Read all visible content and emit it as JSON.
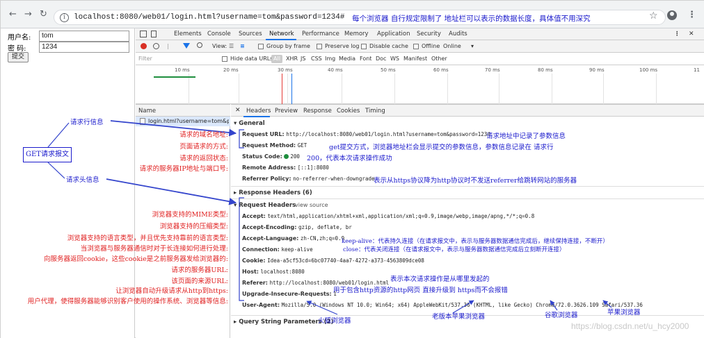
{
  "browser": {
    "url": "localhost:8080/web01/login.html?username=tom&password=1234#",
    "url_note": "每个浏览器 自行规定限制了 地址栏可以表示的数据长度，具体值不用深究"
  },
  "form": {
    "username_label": "用户名:",
    "username_value": "tom",
    "password_label": "密  码:",
    "password_value": "1234",
    "submit_label": "提交"
  },
  "devtools": {
    "tabs": [
      "Elements",
      "Console",
      "Sources",
      "Network",
      "Performance",
      "Memory",
      "Application",
      "Security",
      "Audits"
    ],
    "active_tab": "Network",
    "toolbar": {
      "view_label": "View:",
      "group_by_frame": "Group by frame",
      "preserve_log": "Preserve log",
      "disable_cache": "Disable cache",
      "offline": "Offline",
      "online": "Online"
    },
    "filter": {
      "placeholder": "Filter",
      "hide_data_urls": "Hide data URLs",
      "all": "All",
      "types": [
        "XHR",
        "JS",
        "CSS",
        "Img",
        "Media",
        "Font",
        "Doc",
        "WS",
        "Manifest",
        "Other"
      ]
    },
    "timeline_ticks": [
      "10 ms",
      "20 ms",
      "30 ms",
      "40 ms",
      "50 ms",
      "60 ms",
      "70 ms",
      "80 ms",
      "90 ms",
      "100 ms",
      "11"
    ],
    "name_column": {
      "header": "Name",
      "row": "login.html?username=tom&pa..."
    },
    "detail_tabs": [
      "Headers",
      "Preview",
      "Response",
      "Cookies",
      "Timing"
    ],
    "general": {
      "title": "General",
      "request_url_key": "Request URL:",
      "request_url_val": "http://localhost:8080/web01/login.html?username=tom&password=1234",
      "request_method_key": "Request Method:",
      "request_method_val": "GET",
      "status_code_key": "Status Code:",
      "status_code_val": "200",
      "remote_address_key": "Remote Address:",
      "remote_address_val": "[::1]:8080",
      "referrer_policy_key": "Referrer Policy:",
      "referrer_policy_val": "no-referrer-when-downgrade"
    },
    "response_headers_title": "Response Headers (6)",
    "request_headers": {
      "title": "Request Headers",
      "view_source": "view source",
      "accept_key": "Accept:",
      "accept_val": "text/html,application/xhtml+xml,application/xml;q=0.9,image/webp,image/apng,*/*;q=0.8",
      "accept_encoding_key": "Accept-Encoding:",
      "accept_encoding_val": "gzip, deflate, br",
      "accept_language_key": "Accept-Language:",
      "accept_language_val": "zh-CN,zh;q=0.9",
      "connection_key": "Connection:",
      "connection_val": "keep-alive",
      "cookie_key": "Cookie:",
      "cookie_val": "Idea-a5cf53cd=6bc07740-4aa7-4272-a373-4563809dce08",
      "host_key": "Host:",
      "host_val": "localhost:8080",
      "referer_key": "Referer:",
      "referer_val": "http://localhost:8080/web01/login.html",
      "upgrade_key": "Upgrade-Insecure-Requests:",
      "upgrade_val": "1",
      "user_agent_key": "User-Agent:",
      "user_agent_val": "Mozilla/5.0 (Windows NT 10.0; Win64; x64) AppleWebKit/537.36 (KHTML, like Gecko) Chrome/72.0.3626.109 Safari/537.36"
    },
    "query_string_title": "Query String Parameters (2)"
  },
  "annotations": {
    "request_line": "请求行信息",
    "get_message": "GET请求报文",
    "request_header": "请求头信息",
    "domain": "请求的域名地址:",
    "method": "页面请求的方式:",
    "status": "请求的返回状态:",
    "server_ip": "请求的服务器IP地址与端口号:",
    "mime": "浏览器支持的MIME类型:",
    "compress": "浏览器支持的压缩类型:",
    "language": "浏览器支持的语言类型，并且优先支持靠前的语言类型:",
    "long_conn": "当浏览器与服务器通信时对于长连接如何进行处理:",
    "cookie": "向服务器返回cookie，这些cookie是之前服务器发给浏览器的:",
    "server_url": "请求的服务器URL:",
    "source_url": "该页面的来源URL:",
    "upgrade": "让浏览器自动升级请求从http到https:",
    "user_agent": "用户代理，使得服务器能够识别客户使用的操作系统、浏览器等信息:",
    "url_params": "请求地址中记录了参数信息",
    "get_method": "get提交方式，浏览器地址栏会显示提交的参数信息，参数信息记录在 请求行",
    "code_200": "200，代表本次请求操作成功",
    "referrer_policy": "表示从https协议降为http协议时不发送referrer给跳转网站的服务器",
    "keep_alive": "keep-alive：代表持久连接（在请求报文中，表示与服务器数据通信完成后，继续保持连接，不断开）",
    "close": "close：代表关闭连接（在请求报文中，表示与服务器数据通信完成后立刻断开连接）",
    "referer_note": "表示本次请求操作是从哪里发起的",
    "upgrade_note": "用于包含http资源的http网页 直接升级到 https而不会报错",
    "firefox": "火狐浏览器",
    "old_apple": "老版本苹果浏览器",
    "chrome": "谷歌浏览器",
    "safari": "苹果浏览器"
  },
  "watermark": "https://blog.csdn.net/u_hcy2000"
}
